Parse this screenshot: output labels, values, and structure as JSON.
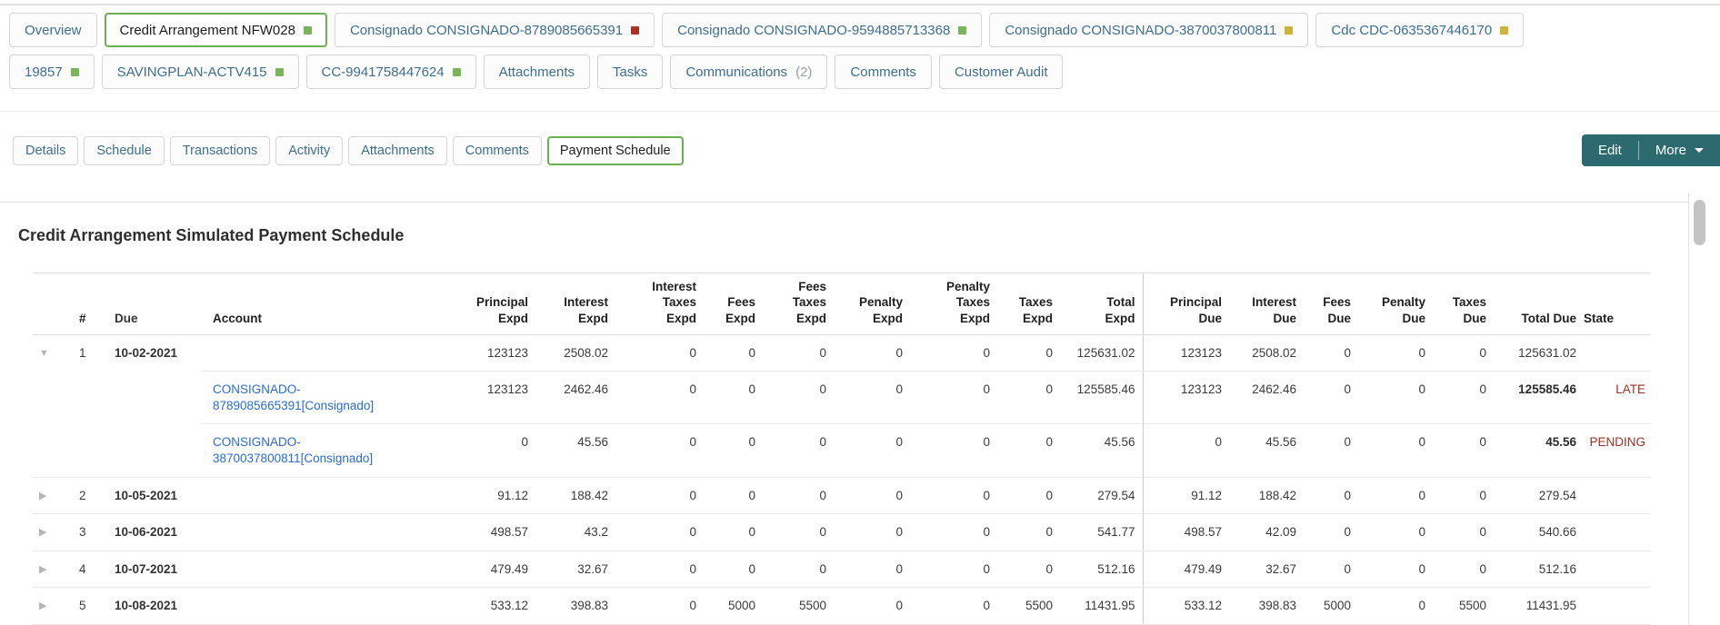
{
  "colors": {
    "accent_green": "#6bb052",
    "button_teal": "#2d6a6f",
    "link_blue": "#2a6bd4",
    "state_red": "#9e2f26",
    "indicator_colors": {
      "green": "#7ab55c",
      "red": "#a93226",
      "yellow": "#ccb33a"
    }
  },
  "tabs_row1": [
    {
      "label": "Overview",
      "indicator": null,
      "active": false
    },
    {
      "label": "Credit Arrangement NFW028",
      "indicator": "green",
      "active": true
    },
    {
      "label": "Consignado CONSIGNADO-8789085665391",
      "indicator": "red",
      "active": false
    },
    {
      "label": "Consignado CONSIGNADO-9594885713368",
      "indicator": "green",
      "active": false
    },
    {
      "label": "Consignado CONSIGNADO-3870037800811",
      "indicator": "yellow",
      "active": false
    },
    {
      "label": "Cdc CDC-0635367446170",
      "indicator": "yellow",
      "active": false
    }
  ],
  "tabs_row2": [
    {
      "label": "19857",
      "indicator": "green",
      "active": false
    },
    {
      "label": "SAVINGPLAN-ACTV415",
      "indicator": "green",
      "active": false
    },
    {
      "label": "CC-9941758447624",
      "indicator": "green",
      "active": false
    },
    {
      "label": "Attachments",
      "indicator": null,
      "active": false
    },
    {
      "label": "Tasks",
      "indicator": null,
      "active": false
    },
    {
      "label": "Communications",
      "count": "(2)",
      "indicator": null,
      "active": false
    },
    {
      "label": "Comments",
      "indicator": null,
      "active": false
    },
    {
      "label": "Customer Audit",
      "indicator": null,
      "active": false
    }
  ],
  "subtabs": [
    {
      "label": "Details",
      "active": false
    },
    {
      "label": "Schedule",
      "active": false
    },
    {
      "label": "Transactions",
      "active": false
    },
    {
      "label": "Activity",
      "active": false
    },
    {
      "label": "Attachments",
      "active": false
    },
    {
      "label": "Comments",
      "active": false
    },
    {
      "label": "Payment Schedule",
      "active": true
    }
  ],
  "actions": {
    "edit": "Edit",
    "more": "More"
  },
  "main": {
    "title": "Credit Arrangement Simulated Payment Schedule"
  },
  "table": {
    "headers": [
      "#",
      "Due",
      "Account",
      "Principal\nExpd",
      "Interest\nExpd",
      "Interest\nTaxes\nExpd",
      "Fees\nExpd",
      "Fees\nTaxes\nExpd",
      "Penalty\nExpd",
      "Penalty\nTaxes\nExpd",
      "Taxes\nExpd",
      "Total\nExpd",
      "Principal\nDue",
      "Interest\nDue",
      "Fees\nDue",
      "Penalty\nDue",
      "Taxes\nDue",
      "Total Due",
      "State"
    ],
    "groups": [
      {
        "num": "1",
        "due": "10-02-2021",
        "expanded": true,
        "row": {
          "values": [
            "123123",
            "2508.02",
            "0",
            "0",
            "0",
            "0",
            "0",
            "0",
            "125631.02",
            "123123",
            "2508.02",
            "0",
            "0",
            "0",
            "125631.02"
          ],
          "state": ""
        },
        "subs": [
          {
            "account": "CONSIGNADO-\n8789085665391[Consignado]",
            "values": [
              "123123",
              "2462.46",
              "0",
              "0",
              "0",
              "0",
              "0",
              "0",
              "125585.46",
              "123123",
              "2462.46",
              "0",
              "0",
              "0",
              "125585.46"
            ],
            "state": "LATE",
            "bold_total": true
          },
          {
            "account": "CONSIGNADO-\n3870037800811[Consignado]",
            "values": [
              "0",
              "45.56",
              "0",
              "0",
              "0",
              "0",
              "0",
              "0",
              "45.56",
              "0",
              "45.56",
              "0",
              "0",
              "0",
              "45.56"
            ],
            "state": "PENDING",
            "bold_total": true
          }
        ]
      },
      {
        "num": "2",
        "due": "10-05-2021",
        "expanded": false,
        "row": {
          "values": [
            "91.12",
            "188.42",
            "0",
            "0",
            "0",
            "0",
            "0",
            "0",
            "279.54",
            "91.12",
            "188.42",
            "0",
            "0",
            "0",
            "279.54"
          ],
          "state": ""
        },
        "subs": []
      },
      {
        "num": "3",
        "due": "10-06-2021",
        "expanded": false,
        "row": {
          "values": [
            "498.57",
            "43.2",
            "0",
            "0",
            "0",
            "0",
            "0",
            "0",
            "541.77",
            "498.57",
            "42.09",
            "0",
            "0",
            "0",
            "540.66"
          ],
          "state": ""
        },
        "subs": []
      },
      {
        "num": "4",
        "due": "10-07-2021",
        "expanded": false,
        "row": {
          "values": [
            "479.49",
            "32.67",
            "0",
            "0",
            "0",
            "0",
            "0",
            "0",
            "512.16",
            "479.49",
            "32.67",
            "0",
            "0",
            "0",
            "512.16"
          ],
          "state": ""
        },
        "subs": []
      },
      {
        "num": "5",
        "due": "10-08-2021",
        "expanded": false,
        "row": {
          "values": [
            "533.12",
            "398.83",
            "0",
            "5000",
            "5500",
            "0",
            "0",
            "5500",
            "11431.95",
            "533.12",
            "398.83",
            "5000",
            "0",
            "5500",
            "11431.95"
          ],
          "state": ""
        },
        "subs": []
      }
    ]
  }
}
